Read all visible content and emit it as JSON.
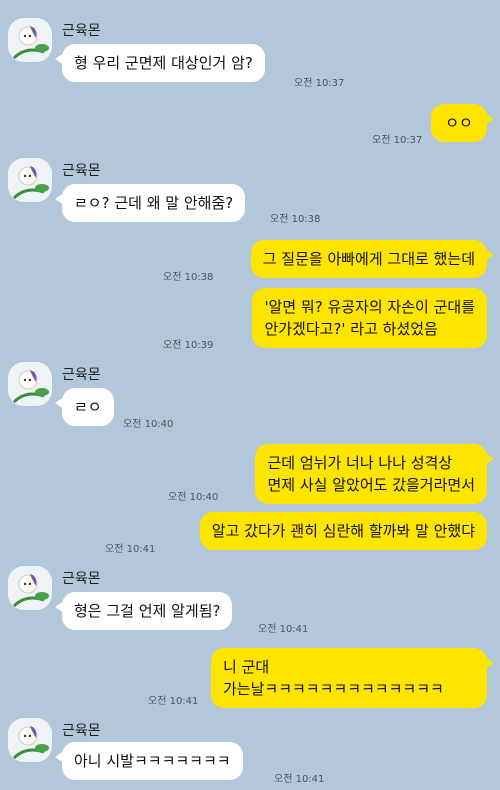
{
  "contact": {
    "name": "근육몬",
    "avatar_icon": "avatar-icon"
  },
  "colors": {
    "background": "#b2c7d9",
    "incoming_bubble": "#ffffff",
    "outgoing_bubble": "#fee500"
  },
  "messages": [
    {
      "sender": "contact",
      "text": "형 우리 군면제 대상인거 암?",
      "time": "오전 10:37"
    },
    {
      "sender": "me",
      "text": "ㅇㅇ",
      "time": "오전 10:37"
    },
    {
      "sender": "contact",
      "text": "ㄹㅇ? 근데 왜 말 안해줌?",
      "time": "오전 10:38"
    },
    {
      "sender": "me",
      "text": "그 질문을 아빠에게 그대로 했는데",
      "time": "오전 10:38"
    },
    {
      "sender": "me",
      "text": "'알면 뭐? 유공자의 자손이 군대를\n안가겠다고?' 라고 하셨었음",
      "time": "오전 10:39"
    },
    {
      "sender": "contact",
      "text": "ㄹㅇ",
      "time": "오전 10:40"
    },
    {
      "sender": "me",
      "text": "근데 엄뉘가 너나 나나 성격상\n면제 사실 알았어도 갔을거라면서",
      "time": "오전 10:40"
    },
    {
      "sender": "me",
      "text": "알고 갔다가 괜히 심란해 할까봐 말 안했댜",
      "time": "오전 10:41"
    },
    {
      "sender": "contact",
      "text": "형은 그걸 언제 알게됨?",
      "time": "오전 10:41"
    },
    {
      "sender": "me",
      "text": "니 군대\n가는날ㅋㅋㅋㅋㅋㅋㅋㅋㅋㅋㅋㅋㅋ",
      "time": "오전 10:41"
    },
    {
      "sender": "contact",
      "text": "아니 시발ㅋㅋㅋㅋㅋㅋㅋ",
      "time": "오전 10:41"
    }
  ]
}
